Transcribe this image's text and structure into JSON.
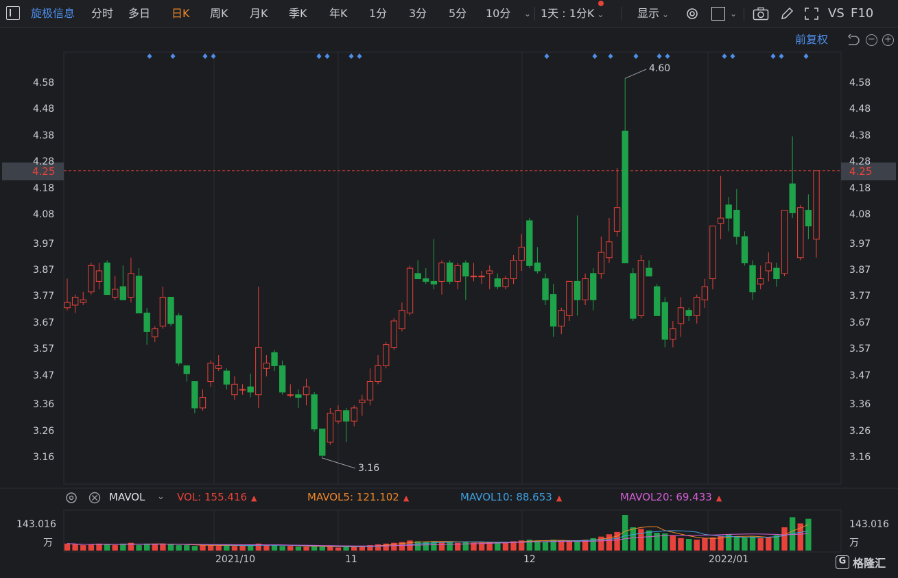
{
  "toolbar": {
    "brand": "旋极信息",
    "items": [
      "分时",
      "多日",
      "日K",
      "周K",
      "月K",
      "季K",
      "年K",
      "1分",
      "3分",
      "5分",
      "10分"
    ],
    "active": "日K",
    "period_select": "1天 : 1分K",
    "display": "显示",
    "vs": "VS",
    "f10": "F10"
  },
  "subbar": {
    "adjust": "前复权"
  },
  "price_axis": {
    "ticks": [
      "4.58",
      "4.48",
      "4.38",
      "4.28",
      "4.18",
      "4.08",
      "3.97",
      "3.87",
      "3.77",
      "3.67",
      "3.57",
      "3.47",
      "3.36",
      "3.26",
      "3.16"
    ],
    "current": "4.25",
    "high_label": "4.60",
    "low_label": "3.16"
  },
  "volume_panel": {
    "indicator": "MAVOL",
    "vol_label": "VOL:",
    "vol_value": "155.416",
    "ma5_label": "MAVOL5:",
    "ma5_value": "121.102",
    "ma10_label": "MAVOL10:",
    "ma10_value": "88.653",
    "ma20_label": "MAVOL20:",
    "ma20_value": "69.433",
    "axis_max": "143.016",
    "unit": "万"
  },
  "dates": [
    "2021/10",
    "11",
    "12",
    "2022/01"
  ],
  "watermark": "格隆汇",
  "colors": {
    "up": "#e8433a",
    "down": "#1fa34a",
    "ma5": "#f0882a",
    "ma10": "#3fa0e0",
    "ma20": "#d45fd6",
    "accent": "#4d8ee8"
  },
  "chart_data": {
    "type": "candlestick",
    "title": "",
    "ylim": [
      3.12,
      4.65
    ],
    "candles": [
      {
        "o": 3.73,
        "h": 3.84,
        "l": 3.72,
        "c": 3.75
      },
      {
        "o": 3.74,
        "h": 3.78,
        "l": 3.71,
        "c": 3.77
      },
      {
        "o": 3.75,
        "h": 3.79,
        "l": 3.74,
        "c": 3.76
      },
      {
        "o": 3.79,
        "h": 3.9,
        "l": 3.78,
        "c": 3.89
      },
      {
        "o": 3.83,
        "h": 3.9,
        "l": 3.8,
        "c": 3.87
      },
      {
        "o": 3.9,
        "h": 3.91,
        "l": 3.78,
        "c": 3.78
      },
      {
        "o": 3.77,
        "h": 3.85,
        "l": 3.76,
        "c": 3.8
      },
      {
        "o": 3.81,
        "h": 3.89,
        "l": 3.77,
        "c": 3.76
      },
      {
        "o": 3.77,
        "h": 3.92,
        "l": 3.75,
        "c": 3.86
      },
      {
        "o": 3.85,
        "h": 3.88,
        "l": 3.72,
        "c": 3.71
      },
      {
        "o": 3.71,
        "h": 3.73,
        "l": 3.59,
        "c": 3.64
      },
      {
        "o": 3.62,
        "h": 3.66,
        "l": 3.6,
        "c": 3.65
      },
      {
        "o": 3.66,
        "h": 3.81,
        "l": 3.65,
        "c": 3.77
      },
      {
        "o": 3.77,
        "h": 3.77,
        "l": 3.66,
        "c": 3.67
      },
      {
        "o": 3.7,
        "h": 3.71,
        "l": 3.51,
        "c": 3.52
      },
      {
        "o": 3.51,
        "h": 3.51,
        "l": 3.45,
        "c": 3.48
      },
      {
        "o": 3.45,
        "h": 3.45,
        "l": 3.33,
        "c": 3.35
      },
      {
        "o": 3.35,
        "h": 3.42,
        "l": 3.34,
        "c": 3.39
      },
      {
        "o": 3.45,
        "h": 3.53,
        "l": 3.43,
        "c": 3.52
      },
      {
        "o": 3.5,
        "h": 3.55,
        "l": 3.49,
        "c": 3.51
      },
      {
        "o": 3.49,
        "h": 3.5,
        "l": 3.42,
        "c": 3.44
      },
      {
        "o": 3.4,
        "h": 3.47,
        "l": 3.38,
        "c": 3.44
      },
      {
        "o": 3.42,
        "h": 3.44,
        "l": 3.4,
        "c": 3.42
      },
      {
        "o": 3.43,
        "h": 3.48,
        "l": 3.39,
        "c": 3.41
      },
      {
        "o": 3.4,
        "h": 3.81,
        "l": 3.35,
        "c": 3.58
      },
      {
        "o": 3.5,
        "h": 3.55,
        "l": 3.47,
        "c": 3.52
      },
      {
        "o": 3.56,
        "h": 3.57,
        "l": 3.49,
        "c": 3.51
      },
      {
        "o": 3.51,
        "h": 3.53,
        "l": 3.4,
        "c": 3.41
      },
      {
        "o": 3.4,
        "h": 3.44,
        "l": 3.39,
        "c": 3.4
      },
      {
        "o": 3.4,
        "h": 3.42,
        "l": 3.35,
        "c": 3.39
      },
      {
        "o": 3.4,
        "h": 3.46,
        "l": 3.36,
        "c": 3.43
      },
      {
        "o": 3.4,
        "h": 3.41,
        "l": 3.26,
        "c": 3.27
      },
      {
        "o": 3.27,
        "h": 3.27,
        "l": 3.16,
        "c": 3.17
      },
      {
        "o": 3.22,
        "h": 3.35,
        "l": 3.21,
        "c": 3.33
      },
      {
        "o": 3.3,
        "h": 3.36,
        "l": 3.29,
        "c": 3.34
      },
      {
        "o": 3.34,
        "h": 3.35,
        "l": 3.22,
        "c": 3.3
      },
      {
        "o": 3.3,
        "h": 3.36,
        "l": 3.28,
        "c": 3.35
      },
      {
        "o": 3.37,
        "h": 3.4,
        "l": 3.32,
        "c": 3.38
      },
      {
        "o": 3.38,
        "h": 3.5,
        "l": 3.36,
        "c": 3.45
      },
      {
        "o": 3.45,
        "h": 3.55,
        "l": 3.44,
        "c": 3.51
      },
      {
        "o": 3.51,
        "h": 3.6,
        "l": 3.5,
        "c": 3.59
      },
      {
        "o": 3.58,
        "h": 3.69,
        "l": 3.57,
        "c": 3.68
      },
      {
        "o": 3.65,
        "h": 3.75,
        "l": 3.64,
        "c": 3.72
      },
      {
        "o": 3.71,
        "h": 3.89,
        "l": 3.7,
        "c": 3.88
      },
      {
        "o": 3.86,
        "h": 3.91,
        "l": 3.84,
        "c": 3.84
      },
      {
        "o": 3.84,
        "h": 3.88,
        "l": 3.82,
        "c": 3.83
      },
      {
        "o": 3.83,
        "h": 3.99,
        "l": 3.8,
        "c": 3.82
      },
      {
        "o": 3.83,
        "h": 3.91,
        "l": 3.78,
        "c": 3.9
      },
      {
        "o": 3.9,
        "h": 3.91,
        "l": 3.82,
        "c": 3.83
      },
      {
        "o": 3.83,
        "h": 3.9,
        "l": 3.8,
        "c": 3.89
      },
      {
        "o": 3.9,
        "h": 3.91,
        "l": 3.76,
        "c": 3.85
      },
      {
        "o": 3.85,
        "h": 3.9,
        "l": 3.83,
        "c": 3.85
      },
      {
        "o": 3.85,
        "h": 3.87,
        "l": 3.82,
        "c": 3.85
      },
      {
        "o": 3.86,
        "h": 3.89,
        "l": 3.8,
        "c": 3.87
      },
      {
        "o": 3.84,
        "h": 3.86,
        "l": 3.8,
        "c": 3.81
      },
      {
        "o": 3.81,
        "h": 3.85,
        "l": 3.8,
        "c": 3.84
      },
      {
        "o": 3.84,
        "h": 3.93,
        "l": 3.82,
        "c": 3.91
      },
      {
        "o": 3.91,
        "h": 4.01,
        "l": 3.87,
        "c": 3.96
      },
      {
        "o": 4.06,
        "h": 4.07,
        "l": 3.88,
        "c": 3.89
      },
      {
        "o": 3.9,
        "h": 3.96,
        "l": 3.86,
        "c": 3.87
      },
      {
        "o": 3.84,
        "h": 3.86,
        "l": 3.74,
        "c": 3.76
      },
      {
        "o": 3.78,
        "h": 3.82,
        "l": 3.62,
        "c": 3.66
      },
      {
        "o": 3.66,
        "h": 3.73,
        "l": 3.63,
        "c": 3.72
      },
      {
        "o": 3.7,
        "h": 3.81,
        "l": 3.68,
        "c": 3.83
      },
      {
        "o": 3.83,
        "h": 4.08,
        "l": 3.7,
        "c": 3.76
      },
      {
        "o": 3.76,
        "h": 3.86,
        "l": 3.74,
        "c": 3.84
      },
      {
        "o": 3.86,
        "h": 3.88,
        "l": 3.72,
        "c": 3.76
      },
      {
        "o": 3.86,
        "h": 4.0,
        "l": 3.84,
        "c": 3.94
      },
      {
        "o": 3.92,
        "h": 4.07,
        "l": 3.9,
        "c": 3.98
      },
      {
        "o": 4.02,
        "h": 4.26,
        "l": 4.0,
        "c": 4.11
      },
      {
        "o": 4.4,
        "h": 4.6,
        "l": 3.9,
        "c": 3.9
      },
      {
        "o": 3.86,
        "h": 3.88,
        "l": 3.68,
        "c": 3.69
      },
      {
        "o": 3.7,
        "h": 3.93,
        "l": 3.69,
        "c": 3.91
      },
      {
        "o": 3.88,
        "h": 3.91,
        "l": 3.85,
        "c": 3.85
      },
      {
        "o": 3.81,
        "h": 3.82,
        "l": 3.7,
        "c": 3.7
      },
      {
        "o": 3.75,
        "h": 3.77,
        "l": 3.58,
        "c": 3.61
      },
      {
        "o": 3.61,
        "h": 3.68,
        "l": 3.58,
        "c": 3.65
      },
      {
        "o": 3.67,
        "h": 3.77,
        "l": 3.62,
        "c": 3.73
      },
      {
        "o": 3.72,
        "h": 3.73,
        "l": 3.68,
        "c": 3.7
      },
      {
        "o": 3.7,
        "h": 3.78,
        "l": 3.67,
        "c": 3.77
      },
      {
        "o": 3.76,
        "h": 3.84,
        "l": 3.73,
        "c": 3.81
      },
      {
        "o": 3.84,
        "h": 4.02,
        "l": 3.8,
        "c": 4.04
      },
      {
        "o": 4.05,
        "h": 4.23,
        "l": 3.99,
        "c": 4.07
      },
      {
        "o": 4.12,
        "h": 4.15,
        "l": 4.02,
        "c": 4.07
      },
      {
        "o": 4.1,
        "h": 4.18,
        "l": 3.97,
        "c": 4.0
      },
      {
        "o": 4.0,
        "h": 4.02,
        "l": 3.89,
        "c": 3.9
      },
      {
        "o": 3.89,
        "h": 3.91,
        "l": 3.76,
        "c": 3.79
      },
      {
        "o": 3.82,
        "h": 3.89,
        "l": 3.8,
        "c": 3.84
      },
      {
        "o": 3.87,
        "h": 3.94,
        "l": 3.83,
        "c": 3.9
      },
      {
        "o": 3.88,
        "h": 3.9,
        "l": 3.81,
        "c": 3.84
      },
      {
        "o": 3.86,
        "h": 4.1,
        "l": 3.85,
        "c": 4.1
      },
      {
        "o": 4.2,
        "h": 4.38,
        "l": 4.07,
        "c": 4.09
      },
      {
        "o": 3.92,
        "h": 4.12,
        "l": 3.91,
        "c": 4.11
      },
      {
        "o": 4.1,
        "h": 4.16,
        "l": 3.99,
        "c": 4.04
      },
      {
        "o": 3.99,
        "h": 4.25,
        "l": 3.92,
        "c": 4.25
      }
    ],
    "volumes": [
      9,
      8,
      7,
      8,
      9,
      8,
      7,
      9,
      10,
      7,
      9,
      8,
      9,
      8,
      7,
      7,
      6,
      7,
      7,
      6,
      7,
      6,
      6,
      7,
      9,
      7,
      7,
      6,
      6,
      5,
      5,
      6,
      5,
      5,
      4,
      5,
      5,
      6,
      7,
      8,
      9,
      10,
      11,
      13,
      12,
      11,
      12,
      11,
      12,
      10,
      11,
      10,
      10,
      11,
      10,
      11,
      12,
      13,
      14,
      13,
      12,
      14,
      13,
      12,
      13,
      14,
      16,
      18,
      21,
      24,
      46,
      30,
      28,
      26,
      23,
      22,
      19,
      16,
      15,
      14,
      16,
      17,
      19,
      21,
      18,
      17,
      18,
      16,
      17,
      20,
      30,
      43,
      35,
      41
    ]
  }
}
